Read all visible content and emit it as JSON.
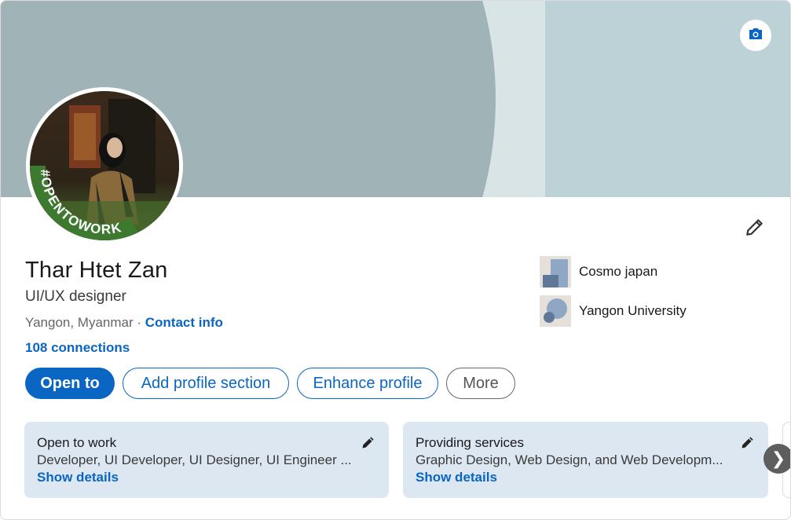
{
  "profile": {
    "name": "Thar Htet Zan",
    "headline": "UI/UX designer",
    "location": "Yangon, Myanmar",
    "separator": " · ",
    "contact_info": "Contact info",
    "connections": "108 connections",
    "avatar_badge": "#OPENTOWORK"
  },
  "orgs": [
    {
      "name": "Cosmo japan"
    },
    {
      "name": "Yangon University"
    }
  ],
  "actions": {
    "open_to": "Open to",
    "add_section": "Add profile section",
    "enhance": "Enhance profile",
    "more": "More"
  },
  "features": [
    {
      "title": "Open to work",
      "description": "Developer, UI Developer, UI Designer, UI Engineer ...",
      "link": "Show details"
    },
    {
      "title": "Providing services",
      "description": "Graphic Design, Web Design, and Web Developm...",
      "link": "Show details"
    }
  ],
  "icons": {
    "camera": "camera-icon",
    "edit": "pencil-icon",
    "next": "chevron-right-icon",
    "next_glyph": "❯"
  },
  "colors": {
    "brand": "#0a66c2",
    "badge_green": "#3d7a2f",
    "card_bg": "#dde7f1"
  }
}
